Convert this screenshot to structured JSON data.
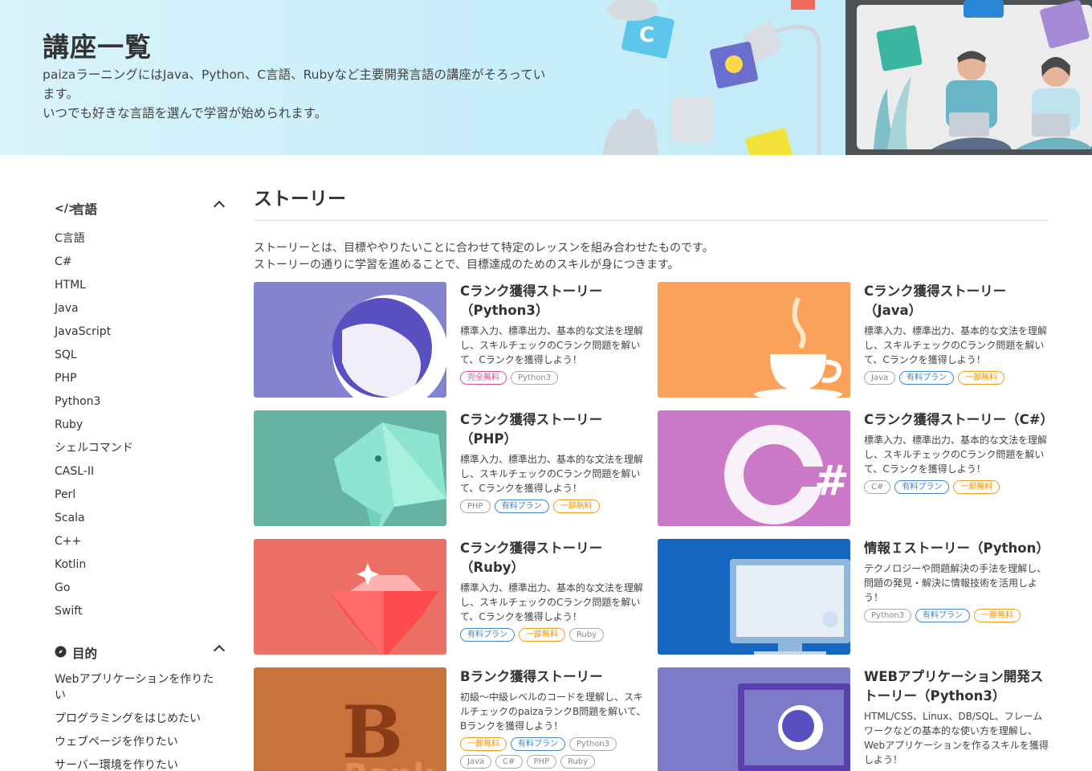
{
  "hero": {
    "title": "講座一覧",
    "desc_line1": "paizaラーニングにはJava、Python、C言語、Rubyなど主要開発言語の講座がそろってい",
    "desc_line2": "ます。",
    "desc_line3": "いつでも好きな言語を選んで学習が始められます。"
  },
  "sidebar": {
    "lang_header": "言語",
    "lang_items": [
      "C言語",
      "C#",
      "HTML",
      "Java",
      "JavaScript",
      "SQL",
      "PHP",
      "Python3",
      "Ruby",
      "シェルコマンド",
      "CASL-II",
      "Perl",
      "Scala",
      "C++",
      "Kotlin",
      "Go",
      "Swift"
    ],
    "goal_header": "目的",
    "goal_items": [
      "Webアプリケーションを作りたい",
      "プログラミングをはじめたい",
      "ウェブページを作りたい",
      "サーバー環境を作りたい"
    ]
  },
  "main": {
    "title": "ストーリー",
    "desc_line1": "ストーリーとは、目標ややりたいことに合わせて特定のレッスンを組み合わせたものです。",
    "desc_line2": "ストーリーの通りに学習を進めることで、目標達成のためのスキルが身につきます。"
  },
  "cards": [
    {
      "title_l1": "Cランク獲得ストーリー",
      "title_l2": "（Python3）",
      "desc": "標準入力、標準出力、基本的な文法を理解し、スキルチェックのCランク問題を解いて、Cランクを獲得しよう！",
      "tags": [
        [
          "完全無料",
          "free"
        ],
        [
          "Python3",
          "lang"
        ]
      ],
      "color": "#8483cf"
    },
    {
      "title_l1": "Cランク獲得ストーリー",
      "title_l2": "（Java）",
      "desc": "標準入力、標準出力、基本的な文法を理解し、スキルチェックのCランク問題を解いて、Cランクを獲得しよう！",
      "tags": [
        [
          "Java",
          "lang"
        ],
        [
          "有料プラン",
          "paid"
        ],
        [
          "一部無料",
          "partial"
        ]
      ],
      "color": "#fba25a"
    },
    {
      "title_l1": "Cランク獲得ストーリー",
      "title_l2": "（PHP）",
      "desc": "標準入力、標準出力、基本的な文法を理解し、スキルチェックのCランク問題を解いて、Cランクを獲得しよう！",
      "tags": [
        [
          "PHP",
          "lang"
        ],
        [
          "有料プラン",
          "paid"
        ],
        [
          "一部無料",
          "partial"
        ]
      ],
      "color": "#66b3a4"
    },
    {
      "title_l1": "Cランク獲得ストーリー（C#）",
      "title_l2": "",
      "desc": "標準入力、標準出力、基本的な文法を理解し、スキルチェックのCランク問題を解いて、Cランクを獲得しよう！",
      "tags": [
        [
          "C#",
          "lang"
        ],
        [
          "有料プラン",
          "paid"
        ],
        [
          "一部無料",
          "partial"
        ]
      ],
      "color": "#cc78c8"
    },
    {
      "title_l1": "Cランク獲得ストーリー",
      "title_l2": "（Ruby）",
      "desc": "標準入力、標準出力、基本的な文法を理解し、スキルチェックのCランク問題を解いて、Cランクを獲得しよう！",
      "tags": [
        [
          "有料プラン",
          "paid"
        ],
        [
          "一部無料",
          "partial"
        ],
        [
          "Ruby",
          "lang"
        ]
      ],
      "color": "#ec7065"
    },
    {
      "title_l1": "情報Ｉストーリー（Python）",
      "title_l2": "",
      "desc": "テクノロジーや問題解決の手法を理解し、問題の発見・解決に情報技術を活用しよう！",
      "tags": [
        [
          "Python3",
          "lang"
        ],
        [
          "有料プラン",
          "paid"
        ],
        [
          "一部無料",
          "partial"
        ]
      ],
      "color": "#1466c0"
    },
    {
      "title_l1": "Bランク獲得ストーリー",
      "title_l2": "",
      "desc": "初級～中級レベルのコードを理解し、スキルチェックのpaizaランクB問題を解いて、Bランクを獲得しよう！",
      "tags": [
        [
          "一部無料",
          "partial"
        ],
        [
          "有料プラン",
          "paid"
        ],
        [
          "Python3",
          "lang"
        ],
        [
          "Java",
          "lang"
        ],
        [
          "C#",
          "lang"
        ],
        [
          "PHP",
          "lang"
        ],
        [
          "Ruby",
          "lang"
        ]
      ],
      "color": "#c8723c"
    },
    {
      "title_l1": "WEBアプリケーション開発ス",
      "title_l2": "トーリー（Python3）",
      "desc": "HTML/CSS、Linux、DB/SQL、フレームワークなどの基本的な使い方を理解し、Webアプリケーションを作るスキルを獲得しよう！",
      "tags": [],
      "color": "#7b7bc9"
    }
  ],
  "thumb_text": {
    "rank_letter": "B",
    "rank_word": "Rank"
  },
  "icons": {
    "code": "code-icon",
    "compass": "compass-icon",
    "chevron": "chevron-up-icon"
  }
}
